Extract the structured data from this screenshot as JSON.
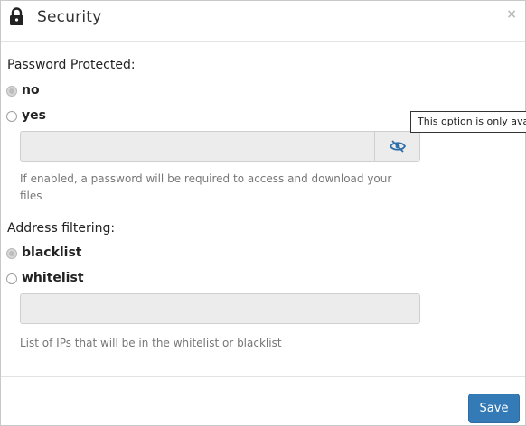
{
  "dialog": {
    "title": "Security",
    "close_label": "×",
    "lock_icon": "lock-icon"
  },
  "password": {
    "section_label": "Password Protected:",
    "options": [
      {
        "label": "no",
        "selected": true
      },
      {
        "label": "yes",
        "selected": false
      }
    ],
    "input_value": "",
    "toggle_icon": "eye-slash-icon",
    "help_text": "If enabled, a password will be required to access and download your files"
  },
  "tooltip": {
    "text": "This option is only available"
  },
  "address": {
    "section_label": "Address filtering:",
    "options": [
      {
        "label": "blacklist",
        "selected": true
      },
      {
        "label": "whitelist",
        "selected": false
      }
    ],
    "input_value": "",
    "help_text": "List of IPs that will be in the whitelist or blacklist"
  },
  "footer": {
    "save_label": "Save"
  },
  "colors": {
    "primary": "#337ab7",
    "icon_blue": "#2f6fa8",
    "input_bg": "#ececec"
  }
}
